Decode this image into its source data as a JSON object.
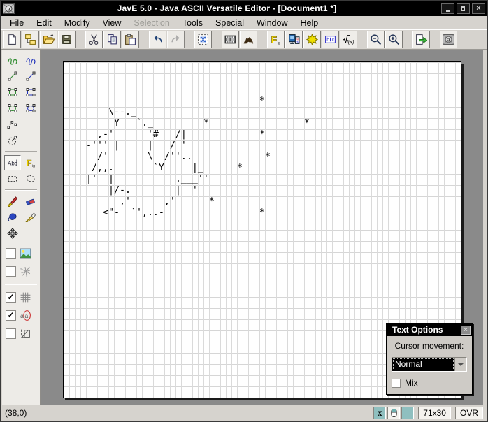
{
  "window": {
    "title": "JavE 5.0 - Java ASCII Versatile Editor - [Document1 *]",
    "controls": [
      "minimize",
      "maximize",
      "close"
    ]
  },
  "menu": {
    "items": [
      {
        "label": "File",
        "enabled": true
      },
      {
        "label": "Edit",
        "enabled": true
      },
      {
        "label": "Modify",
        "enabled": true
      },
      {
        "label": "View",
        "enabled": true
      },
      {
        "label": "Selection",
        "enabled": false
      },
      {
        "label": "Tools",
        "enabled": true
      },
      {
        "label": "Special",
        "enabled": true
      },
      {
        "label": "Window",
        "enabled": true
      },
      {
        "label": "Help",
        "enabled": true
      }
    ]
  },
  "toolbar": {
    "groups": [
      {
        "buttons": [
          {
            "icon": "new-document"
          },
          {
            "icon": "new-from-template"
          },
          {
            "icon": "open-file"
          },
          {
            "icon": "save-file"
          }
        ]
      },
      {
        "buttons": [
          {
            "icon": "cut"
          },
          {
            "icon": "copy"
          },
          {
            "icon": "paste"
          }
        ]
      },
      {
        "buttons": [
          {
            "icon": "undo"
          },
          {
            "icon": "redo",
            "disabled": true
          }
        ]
      },
      {
        "buttons": [
          {
            "icon": "resize-canvas"
          }
        ]
      },
      {
        "buttons": [
          {
            "icon": "animation-editor"
          },
          {
            "icon": "image-to-ascii-camel"
          }
        ]
      },
      {
        "buttons": [
          {
            "icon": "figlet-editor"
          },
          {
            "icon": "ascii-converter"
          },
          {
            "icon": "effects"
          },
          {
            "icon": "text-editor"
          },
          {
            "icon": "formula-editor"
          }
        ]
      },
      {
        "buttons": [
          {
            "icon": "zoom-out"
          },
          {
            "icon": "zoom-in"
          }
        ]
      },
      {
        "buttons": [
          {
            "icon": "export"
          }
        ]
      },
      {
        "buttons": [
          {
            "icon": "jave-info"
          }
        ]
      }
    ]
  },
  "sidebar": {
    "tool_rows": [
      {
        "tools": [
          "freehand-line-tool",
          "freehand-fill-tool"
        ]
      },
      {
        "tools": [
          "straight-line-tool",
          "straight-line-alt-tool"
        ]
      },
      {
        "tools": [
          "rectangle-tool",
          "filled-rectangle-tool"
        ]
      },
      {
        "tools": [
          "ellipse-tool",
          "filled-ellipse-tool"
        ]
      },
      {
        "tools": [
          "curve-tool",
          null
        ]
      },
      {
        "tools": [
          "arc-tool",
          null
        ]
      },
      {
        "separator": true
      },
      {
        "tools": [
          "text-tool",
          "figlet-tool"
        ],
        "active": "text-tool"
      },
      {
        "tools": [
          "rect-select-tool",
          "freehand-select-tool"
        ]
      },
      {
        "separator": true
      },
      {
        "tools": [
          "brush-tool",
          "eraser-tool"
        ]
      },
      {
        "tools": [
          "fill-tool",
          "pen-tool"
        ]
      },
      {
        "tools": [
          "move-tool",
          null
        ]
      }
    ],
    "toggles": [
      {
        "icon": "background-image",
        "checked": false
      },
      {
        "icon": "mikado",
        "checked": false
      },
      {
        "separator": true
      },
      {
        "icon": "show-grid",
        "checked": true
      },
      {
        "icon": "extended-characters",
        "checked": true
      },
      {
        "icon": "selection-frame",
        "checked": false
      }
    ],
    "check_glyph": "✓"
  },
  "canvas": {
    "cols": 71,
    "rows_count": 30,
    "rows": [
      "",
      "",
      "",
      "                                   *",
      "        \\--._",
      "         Y   `._         *                 *",
      "      ,-'      '#   /|             *",
      "    -''' |     |   / '",
      "      /'       \\  /''..             *",
      "     /,,.       `Y     |_      *",
      "    |'  |           .___''",
      "        |/-.        |  '",
      "          ,'      ,'      *",
      "       <\"-  `',..-                 *",
      "",
      "",
      "",
      "",
      "",
      "",
      "",
      "",
      "",
      "",
      "",
      "",
      "",
      "",
      "",
      ""
    ]
  },
  "dialog": {
    "title": "Text Options",
    "close_glyph": "×",
    "label": "Cursor movement:",
    "dropdown_value": "Normal",
    "checkbox_label": "Mix",
    "checkbox_checked": false
  },
  "statusbar": {
    "cursor_position": "(38,0)",
    "x_indicator": "x",
    "canvas_size": "71x30",
    "mode": "OVR"
  }
}
